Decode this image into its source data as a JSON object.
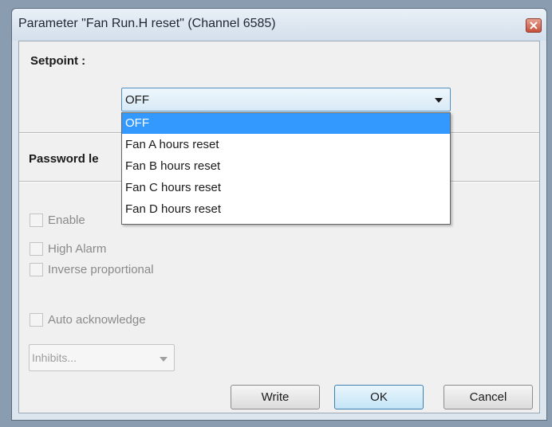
{
  "window": {
    "title": "Parameter \"Fan Run.H reset\" (Channel 6585)"
  },
  "setpoint": {
    "label": "Setpoint :",
    "value": "OFF",
    "options": [
      "OFF",
      "Fan A hours reset",
      "Fan B hours reset",
      "Fan C hours reset",
      "Fan D hours reset"
    ],
    "selected_index": 0
  },
  "password": {
    "label": "Password le"
  },
  "checkboxes": {
    "enable": "Enable",
    "high_alarm": "High Alarm",
    "inverse_proportional": "Inverse proportional",
    "auto_acknowledge": "Auto acknowledge"
  },
  "inhibits": {
    "value": "Inhibits..."
  },
  "buttons": {
    "write": "Write",
    "ok": "OK",
    "cancel": "Cancel"
  },
  "colors": {
    "selection": "#3399ff",
    "disabled_text": "#8a8a8a"
  }
}
